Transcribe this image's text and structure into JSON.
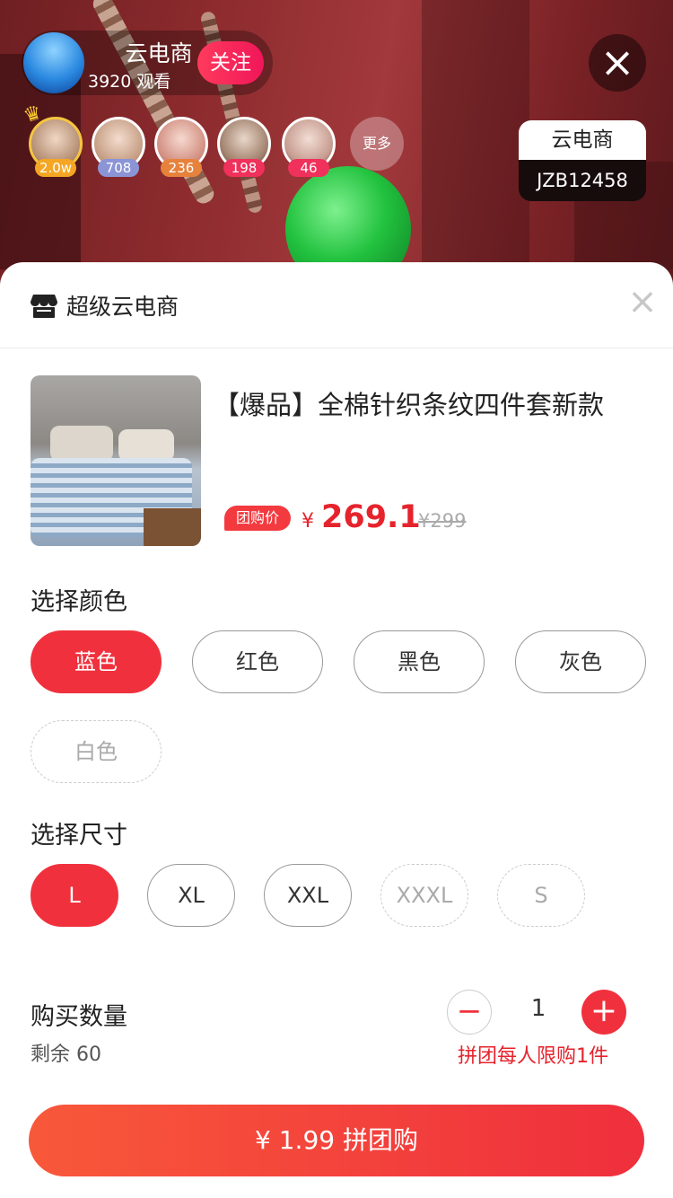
{
  "host": {
    "name": "云电商",
    "viewers": "3920 观看",
    "follow_label": "关注"
  },
  "viewers": [
    {
      "count": "2.0w",
      "count_color": "#f5a623"
    },
    {
      "count": "708",
      "count_color": "#8b95d6"
    },
    {
      "count": "236",
      "count_color": "#e6823c"
    },
    {
      "count": "198",
      "count_color": "#f0315b"
    },
    {
      "count": "46",
      "count_color": "#f0315b"
    }
  ],
  "more_label": "更多",
  "room": {
    "name": "云电商",
    "id": "JZB12458"
  },
  "sheet": {
    "shop_name": "超级云电商",
    "product": {
      "title": "【爆品】全棉针织条纹四件套新款",
      "price_tag": "团购价",
      "currency": "¥",
      "price": "269.1",
      "old_price": "¥299"
    },
    "color_section": {
      "label": "选择颜色",
      "options": [
        {
          "label": "蓝色",
          "state": "selected"
        },
        {
          "label": "红色",
          "state": "normal"
        },
        {
          "label": "黑色",
          "state": "normal"
        },
        {
          "label": "灰色",
          "state": "normal"
        },
        {
          "label": "白色",
          "state": "disabled"
        }
      ]
    },
    "size_section": {
      "label": "选择尺寸",
      "options": [
        {
          "label": "L",
          "state": "selected"
        },
        {
          "label": "XL",
          "state": "normal"
        },
        {
          "label": "XXL",
          "state": "normal"
        },
        {
          "label": "XXXL",
          "state": "disabled"
        },
        {
          "label": "S",
          "state": "disabled"
        }
      ]
    },
    "quantity": {
      "label": "购买数量",
      "stock": "剩余 60",
      "value": "1",
      "limit_text": "拼团每人限购1件"
    },
    "buy_button": "¥ 1.99 拼团购"
  },
  "colors": {
    "accent": "#f0313d",
    "price": "#e6232c"
  }
}
